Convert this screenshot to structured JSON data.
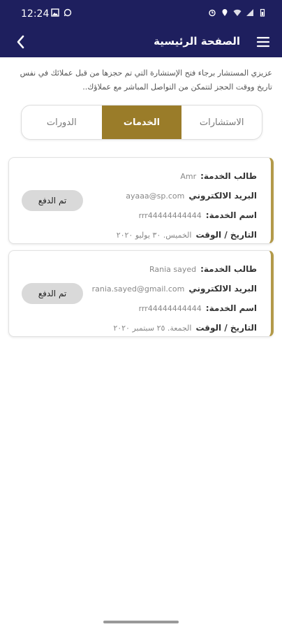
{
  "statusbar": {
    "time": "12:24"
  },
  "appbar": {
    "title": "الصفحة الرئيسية"
  },
  "intro": "عزيزي المستشار برجاء فتح الإستشارة التي تم حجزها من قبل عملائك في نفس تاريخ ووقت الحجز لتتمكن من التواصل المباشر مع عملاؤك..",
  "tabs": [
    {
      "label": "الاستشارات",
      "active": false
    },
    {
      "label": "الخدمات",
      "active": true
    },
    {
      "label": "الدورات",
      "active": false
    }
  ],
  "cards": [
    {
      "requester_label": "طالب الخدمة:",
      "requester": "Amr",
      "email_label": "البريد الالكتروني",
      "email": "ayaaa@sp.com",
      "service_label": "اسم الخدمة:",
      "service": "rrr44444444444",
      "datetime_label": "التاريخ / الوقت",
      "datetime": "الخميس. ٣٠ يوليو ٢٠٢٠",
      "status": "تم الدفع"
    },
    {
      "requester_label": "طالب الخدمة:",
      "requester": "Rania sayed",
      "email_label": "البريد الالكتروني",
      "email": "rania.sayed@gmail.com",
      "service_label": "اسم الخدمة:",
      "service": "rrr44444444444",
      "datetime_label": "التاريخ / الوقت",
      "datetime": "الجمعة. ٢٥ سبتمبر ٢٠٢٠",
      "status": "تم الدفع"
    }
  ],
  "colors": {
    "primary": "#1e1f5e",
    "accent": "#9a7c29",
    "card_border": "#b39a4a"
  },
  "icons": [
    "image-icon",
    "whatsapp-icon",
    "alarm-icon",
    "location-icon",
    "wifi-icon",
    "signal-icon",
    "battery-icon",
    "back-arrow-icon",
    "menu-icon"
  ]
}
